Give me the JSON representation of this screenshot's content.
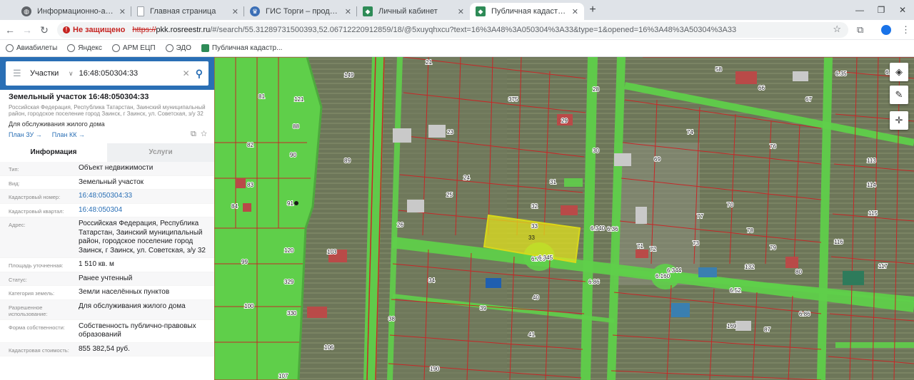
{
  "browser": {
    "tabs": [
      {
        "title": "Информационно-аналитическ",
        "icon": "globe-icon",
        "active": false
      },
      {
        "title": "Главная страница",
        "icon": "page-icon",
        "active": false
      },
      {
        "title": "ГИС Торги – продажи государ",
        "icon": "emblem-icon",
        "active": false
      },
      {
        "title": "Личный кабинет",
        "icon": "shield-icon",
        "active": false
      },
      {
        "title": "Публичная кадастровая карта",
        "icon": "map-icon",
        "active": true
      }
    ],
    "insecure_label": "Не защищено",
    "url_scheme": "https://",
    "url_host": "pkk.rosreestr.ru",
    "url_rest": "/#/search/55.31289731500393,52.06712220912859/18/@5xuyqhxcu?text=16%3A48%3A050304%3A33&type=1&opened=16%3A48%3A50304%3A33",
    "bookmarks": [
      "Авиабилеты",
      "Яндекс",
      "АРМ ЕЦП",
      "ЭДО",
      "Публичная кадастр..."
    ]
  },
  "search": {
    "type_label": "Участки",
    "query": "16:48:050304:33"
  },
  "object": {
    "title": "Земельный участок 16:48:050304:33",
    "address": "Российская Федерация, Республика Татарстан, Заинский муниципальный район, городское поселение город Заинск, г Заинск, ул. Советская, з/у 32",
    "purpose": "Для обслуживания жилого дома",
    "plan_zu": "План ЗУ →",
    "plan_kk": "План КК →"
  },
  "tabs": {
    "info": "Информация",
    "services": "Услуги"
  },
  "attributes": [
    {
      "label": "Тип:",
      "value": "Объект недвижимости",
      "link": false
    },
    {
      "label": "Вид:",
      "value": "Земельный участок",
      "link": false
    },
    {
      "label": "Кадастровый номер:",
      "value": "16:48:050304:33",
      "link": true
    },
    {
      "label": "Кадастровый квартал:",
      "value": "16:48:050304",
      "link": true
    },
    {
      "label": "Адрес:",
      "value": "Российская Федерация, Республика Татарстан, Заинский муниципальный район, городское поселение город Заинск, г Заинск, ул. Советская, з/у 32",
      "link": false
    },
    {
      "label": "Площадь уточненная:",
      "value": "1 510 кв. м",
      "link": false
    },
    {
      "label": "Статус:",
      "value": "Ранее учтенный",
      "link": false
    },
    {
      "label": "Категория земель:",
      "value": "Земли населённых пунктов",
      "link": false
    },
    {
      "label": "Разрешенное использование:",
      "value": "Для обслуживания жилого дома",
      "link": false
    },
    {
      "label": "Форма собственности:",
      "value": "Собственность публично-правовых образований",
      "link": false
    },
    {
      "label": "Кадастровая стоимость:",
      "value": "855 382,54 руб.",
      "link": false
    }
  ],
  "map": {
    "parcel_labels": [
      "149",
      "81",
      "121",
      "88",
      "82",
      "90",
      "83",
      "84",
      "91",
      "89",
      "120",
      "99",
      "103",
      "100",
      "329",
      "330",
      "106",
      "107",
      "21",
      "375",
      "28",
      "23",
      "29",
      "30",
      "24",
      "31",
      "25",
      "32",
      "26",
      "33",
      "34",
      "39",
      "40",
      "41",
      "38",
      "190",
      "58",
      "66",
      "67",
      "74",
      "76",
      "69",
      "70",
      "71",
      "72",
      "73",
      "77",
      "78",
      "79",
      "80",
      "132",
      "113",
      "114",
      "115",
      "116",
      "117",
      "169",
      "87",
      "6.730",
      "6.340",
      "6.36",
      "6.345",
      "6.160",
      "6.344",
      "6.52",
      "6.86",
      "6.86",
      "6.35",
      "6.80"
    ],
    "highlight_parcel": "33"
  },
  "colors": {
    "accent": "#2a6fb5",
    "parcel_green": "#5fcf4a",
    "highlight": "#e4e41c",
    "boundary": "#c62828"
  }
}
